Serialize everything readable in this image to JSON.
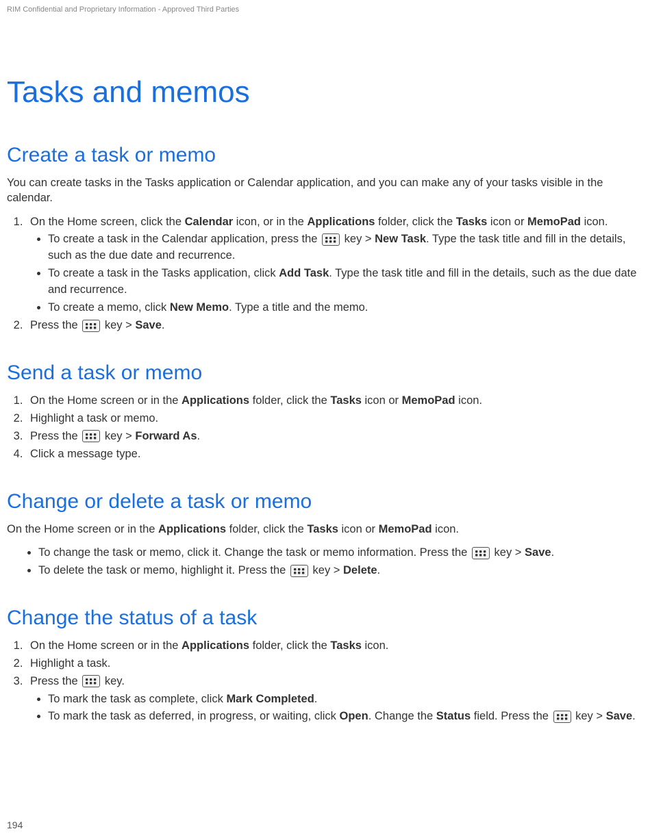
{
  "header": {
    "confidential": "RIM Confidential and Proprietary Information - Approved Third Parties"
  },
  "title": "Tasks and memos",
  "s1": {
    "heading": "Create a task or memo",
    "intro": "You can create tasks in the Tasks application or Calendar application, and you can make any of your tasks visible in the calendar.",
    "step1_a": "On the Home screen, click the ",
    "step1_b": "Calendar",
    "step1_c": " icon, or in the ",
    "step1_d": "Applications",
    "step1_e": " folder, click the ",
    "step1_f": "Tasks",
    "step1_g": " icon or ",
    "step1_h": "MemoPad",
    "step1_i": " icon.",
    "b1_a": "To create a task in the Calendar application, press the ",
    "b1_b": " key > ",
    "b1_c": "New Task",
    "b1_d": ". Type the task title and fill in the details, such as the due date and recurrence.",
    "b2_a": "To create a task in the Tasks application, click ",
    "b2_b": "Add Task",
    "b2_c": ". Type the task title and fill in the details, such as the due date and recurrence.",
    "b3_a": "To create a memo, click ",
    "b3_b": "New Memo",
    "b3_c": ". Type a title and the memo.",
    "step2_a": "Press the ",
    "step2_b": " key > ",
    "step2_c": "Save",
    "step2_d": "."
  },
  "s2": {
    "heading": "Send a task or memo",
    "l1_a": "On the Home screen or in the ",
    "l1_b": "Applications",
    "l1_c": " folder, click the ",
    "l1_d": "Tasks",
    "l1_e": " icon or ",
    "l1_f": "MemoPad",
    "l1_g": " icon.",
    "l2": "Highlight a task or memo.",
    "l3_a": "Press the ",
    "l3_b": " key > ",
    "l3_c": "Forward As",
    "l3_d": ".",
    "l4": "Click a message type."
  },
  "s3": {
    "heading": "Change or delete a task or memo",
    "p_a": "On the Home screen or in the ",
    "p_b": "Applications",
    "p_c": " folder, click the ",
    "p_d": "Tasks",
    "p_e": " icon or ",
    "p_f": "MemoPad",
    "p_g": " icon.",
    "b1_a": "To change the task or memo, click it. Change the task or memo information. Press the ",
    "b1_b": " key > ",
    "b1_c": "Save",
    "b1_d": ".",
    "b2_a": "To delete the task or memo, highlight it. Press the ",
    "b2_b": " key > ",
    "b2_c": "Delete",
    "b2_d": "."
  },
  "s4": {
    "heading": "Change the status of a task",
    "l1_a": "On the Home screen or in the ",
    "l1_b": "Applications",
    "l1_c": " folder, click the ",
    "l1_d": "Tasks",
    "l1_e": " icon.",
    "l2": "Highlight a task.",
    "l3_a": "Press the ",
    "l3_b": " key.",
    "b1_a": "To mark the task as complete, click ",
    "b1_b": "Mark Completed",
    "b1_c": ".",
    "b2_a": "To mark the task as deferred, in progress, or waiting, click ",
    "b2_b": "Open",
    "b2_c": ". Change the ",
    "b2_d": "Status",
    "b2_e": " field. Press the ",
    "b2_f": " key > ",
    "b2_g": "Save",
    "b2_h": "."
  },
  "page_number": "194"
}
